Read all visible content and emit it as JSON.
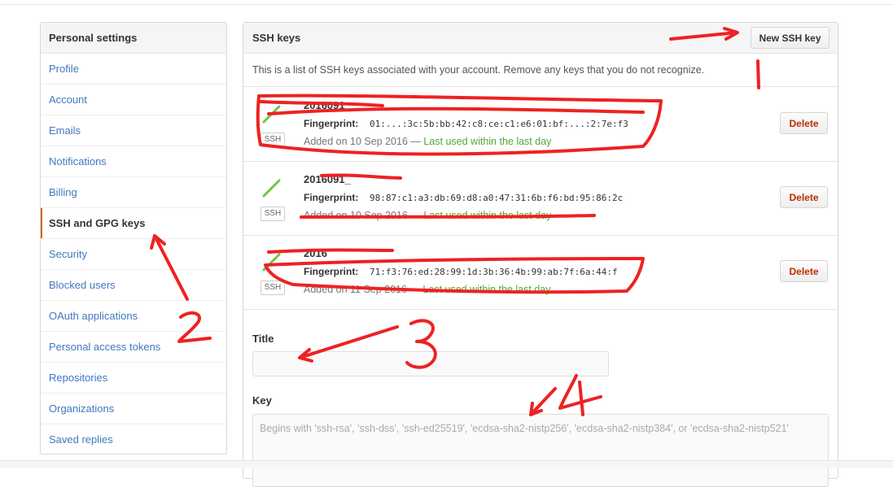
{
  "sidebar": {
    "header": "Personal settings",
    "items": [
      {
        "label": "Profile"
      },
      {
        "label": "Account"
      },
      {
        "label": "Emails"
      },
      {
        "label": "Notifications"
      },
      {
        "label": "Billing"
      },
      {
        "label": "SSH and GPG keys",
        "selected": true
      },
      {
        "label": "Security"
      },
      {
        "label": "Blocked users"
      },
      {
        "label": "OAuth applications"
      },
      {
        "label": "Personal access tokens"
      },
      {
        "label": "Repositories"
      },
      {
        "label": "Organizations"
      },
      {
        "label": "Saved replies"
      }
    ]
  },
  "panel": {
    "title": "SSH keys",
    "new_key_label": "New SSH key",
    "intro": "This is a list of SSH keys associated with your account. Remove any keys that you do not recognize.",
    "keys": [
      {
        "title": "2016091_",
        "fingerprint_label": "Fingerprint:",
        "fingerprint": "01:...:3c:5b:bb:42:c8:ce:c1:e6:01:bf:...:2:7e:f3",
        "badge": "SSH",
        "added": "Added on 10 Sep 2016",
        "sep": " — ",
        "used": "Last used within the last day",
        "delete_label": "Delete"
      },
      {
        "title": "2016091_",
        "fingerprint_label": "Fingerprint:",
        "fingerprint": "98:87:c1:a3:db:69:d8:a0:47:31:6b:f6:bd:95:86:2c",
        "badge": "SSH",
        "added": "Added on 10 Sep 2016",
        "sep": " — ",
        "used": "Last used within the last day",
        "delete_label": "Delete"
      },
      {
        "title": "2016",
        "fingerprint_label": "Fingerprint:",
        "fingerprint": "71:f3:76:ed:28:99:1d:3b:36:4b:99:ab:7f:6a:44:f",
        "badge": "SSH",
        "added": "Added on 11 Sep 2016",
        "sep": " — ",
        "used": "Last used within the last day",
        "delete_label": "Delete"
      }
    ],
    "form": {
      "title_label": "Title",
      "title_value": "",
      "key_label": "Key",
      "key_placeholder": "Begins with 'ssh-rsa', 'ssh-dss', 'ssh-ed25519', 'ecdsa-sha2-nistp256', 'ecdsa-sha2-nistp384', or 'ecdsa-sha2-nistp521'"
    }
  },
  "colors": {
    "link": "#4078c0",
    "selected_accent": "#d26911",
    "used_green": "#55a532",
    "delete_red": "#bd2c00",
    "annotation_red": "#ee2222",
    "key_icon_green": "#6cc644"
  },
  "annotations": {
    "marks": [
      "1",
      "2",
      "3",
      "4"
    ]
  }
}
